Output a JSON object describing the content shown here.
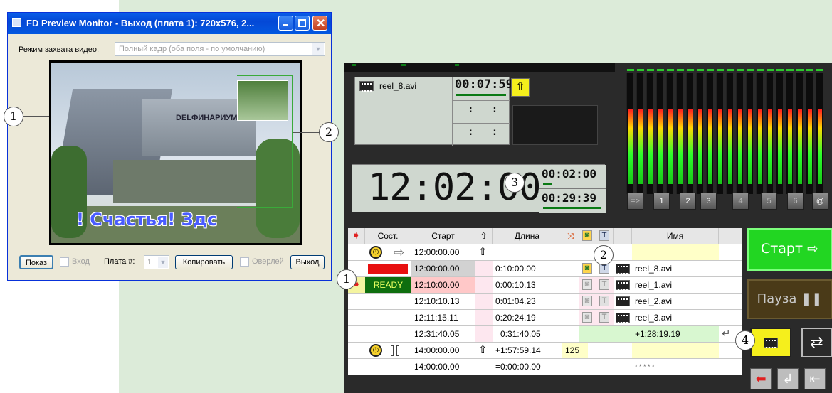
{
  "preview_window": {
    "title": "FD Preview Monitor - Выход (плата 1): 720x576, 2...",
    "capture_mode_label": "Режим захвата видео:",
    "capture_mode_value": "Полный кадр (оба поля - по умолчанию)",
    "video_caption": "! Счастья! Здс",
    "video_sign": "DELФИНАРИУМ",
    "show_button": "Показ",
    "input_label": "Вход",
    "board_label": "Плата #:",
    "board_value": "1",
    "copy_button": "Копировать",
    "overlay_label": "Оверлей",
    "exit_button": "Выход"
  },
  "callouts": {
    "c1a": "1",
    "c2a": "2",
    "c3": "3",
    "c2b": "2",
    "c1b": "1",
    "c4": "4"
  },
  "playout": {
    "current_clip": {
      "name": "reel_8.avi",
      "remaining": "00:07:59",
      "slot2": ":   :",
      "slot3": ":   :"
    },
    "clock": {
      "time": "12:02:00",
      "timer1": "00:02:00",
      "timer2": "00:29:39"
    },
    "channels": [
      "=>",
      "1",
      "2",
      "3",
      "4",
      "5",
      "6",
      "@"
    ],
    "columns": {
      "state": "Сост.",
      "start": "Старт",
      "length": "Длина",
      "t": "T",
      "name": "Имя"
    },
    "rows": [
      {
        "state": "",
        "start": "12:00:00.00",
        "length": "",
        "name": ""
      },
      {
        "state": "",
        "start": "12:00:00.00",
        "length": "0:10:00.00",
        "name": "reel_8.avi"
      },
      {
        "state": "READY",
        "start": "12:10:00.00",
        "length": "0:00:10.13",
        "name": "reel_1.avi"
      },
      {
        "state": "",
        "start": "12:10:10.13",
        "length": "0:01:04.23",
        "name": "reel_2.avi"
      },
      {
        "state": "",
        "start": "12:11:15.11",
        "length": "0:20:24.19",
        "name": "reel_3.avi"
      },
      {
        "state": "",
        "start": "12:31:40.05",
        "length": "=0:31:40.05",
        "name": "+1:28:19.19"
      },
      {
        "state": "",
        "start": "14:00:00.00",
        "length": "+1:57:59.14",
        "extra": "125",
        "name": ""
      },
      {
        "state": "",
        "start": "14:00:00.00",
        "length": "=0:00:00.00",
        "name": "* * * * *"
      }
    ],
    "start_button": "Старт",
    "pause_button": "Пауза"
  },
  "colors": {
    "xp_title": "#0448d6",
    "panel_bg": "#2a2a2a",
    "start_green": "#22d622",
    "pause_brown": "#4a3a18",
    "ready_green": "#0e6e0e",
    "status_red": "#e81010",
    "highlight_yellow": "#f5ef1c"
  }
}
